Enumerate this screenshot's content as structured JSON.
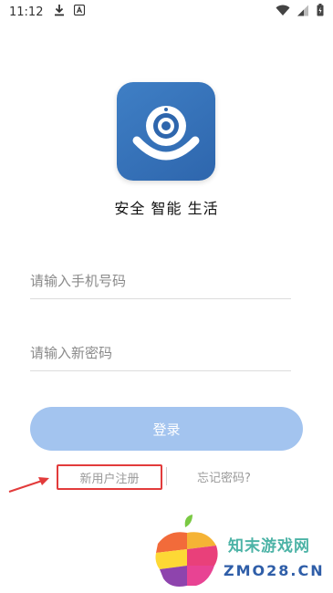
{
  "status_bar": {
    "time": "11:12",
    "icons": [
      "download-icon",
      "app-notification-icon",
      "wifi-icon",
      "signal-icon",
      "battery-icon"
    ]
  },
  "app": {
    "logo_icon": "camera-icon",
    "slogan": "安全 智能 生活",
    "accent_color": "#2e66ad"
  },
  "form": {
    "phone_placeholder": "请输入手机号码",
    "password_placeholder": "请输入新密码",
    "login_label": "登录",
    "login_color": "#a3c4ef"
  },
  "links": {
    "register": "新用户注册",
    "forgot": "忘记密码?"
  },
  "annotation": {
    "highlight_color": "#e23b3b"
  },
  "watermark": {
    "title": "知末游戏网",
    "domain": "ZMO28.CN"
  }
}
